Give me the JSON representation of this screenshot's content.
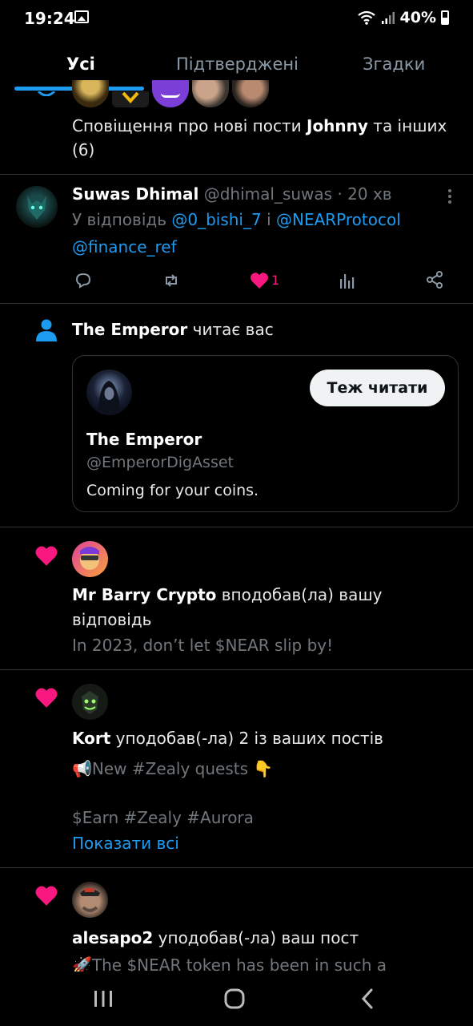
{
  "status": {
    "time": "19:24",
    "battery": "40%"
  },
  "tabs": [
    {
      "label": "Усі",
      "active": true
    },
    {
      "label": "Підтверджені",
      "active": false
    },
    {
      "label": "Згадки",
      "active": false
    }
  ],
  "group_notification": {
    "prefix": "Сповіщення про нові пости ",
    "name": "Johnny",
    "suffix": " та інших",
    "count": "(6)"
  },
  "reply_post": {
    "name": "Suwas Dhimal",
    "handle": "@dhimal_suwas",
    "time": "· 20 хв",
    "reply_prefix": "У відповідь ",
    "mention1": "@0_bishi_7",
    "conj": " і ",
    "mention2": "@NEARProtocol",
    "mention3": "@finance_ref",
    "like_count": "1"
  },
  "follow_notification": {
    "name": "The Emperor",
    "action": " читає вас",
    "card": {
      "name": "The Emperor",
      "handle": "@EmperorDigAsset",
      "bio": "Coming for your coins.",
      "button": "Теж читати"
    }
  },
  "likes": [
    {
      "name": "Mr Barry Crypto",
      "action_line1": " вподобав(ла) вашу",
      "action_line2": "відповідь",
      "snippet": "In 2023, don’t let $NEAR slip by!"
    },
    {
      "name": "Kort",
      "action": " уподобав(-ла) 2 із ваших постів",
      "snippet1": "📢New #Zealy quests 👇",
      "snippet2": "$Earn #Zealy #Aurora",
      "show_all": "Показати всі"
    },
    {
      "name": "alesapo2",
      "action": " уподобав(-ла) ваш пост",
      "snippet": "🚀The $NEAR token has been in such a"
    }
  ],
  "colors": {
    "accent": "#1d9bf0",
    "like": "#f91880",
    "bg": "#000000"
  }
}
